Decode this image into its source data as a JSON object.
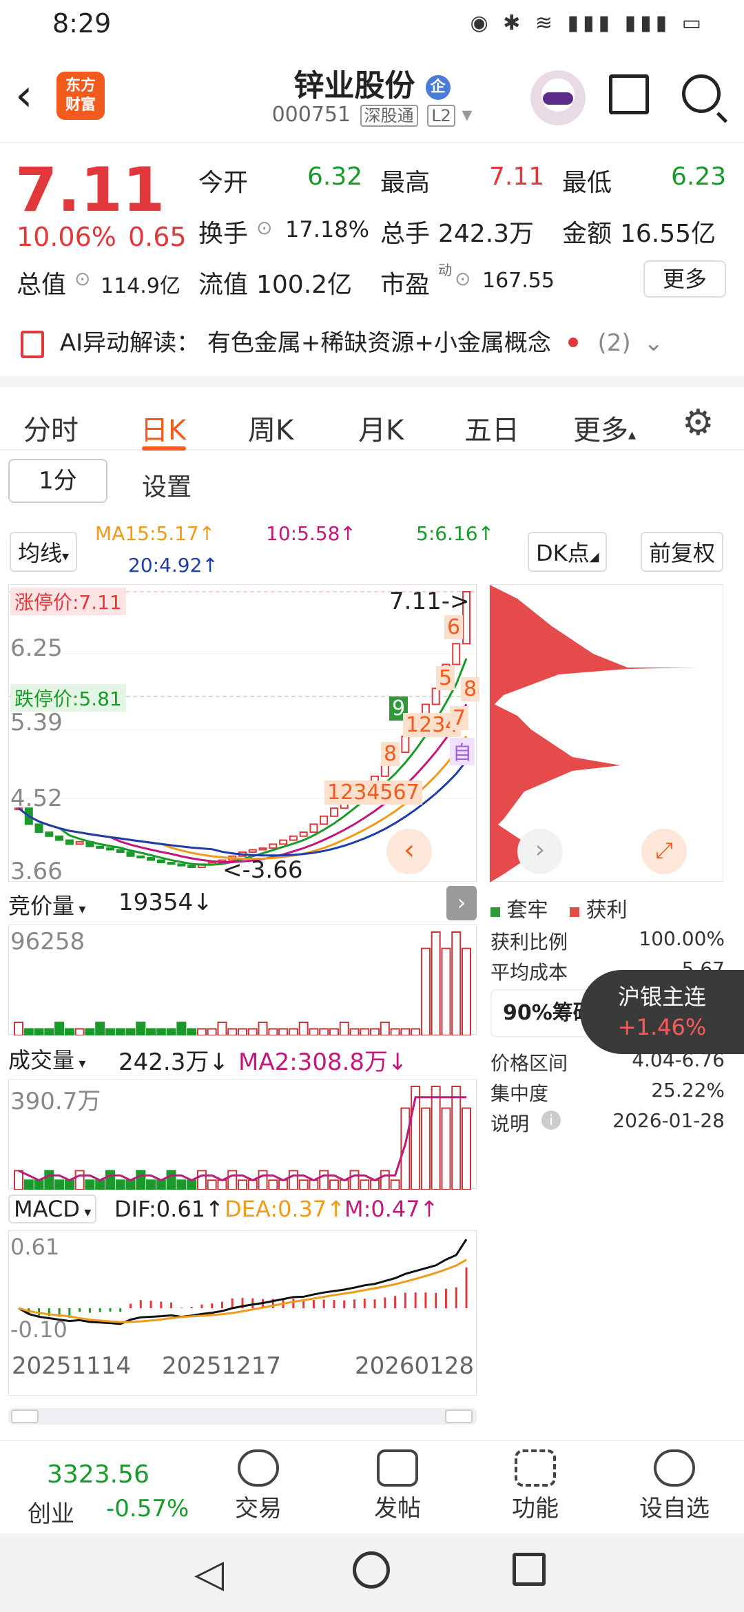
{
  "status": {
    "time": "8:29"
  },
  "header": {
    "logo_line1": "东方",
    "logo_line2": "财富",
    "name": "锌业股份",
    "name_badge": "企",
    "code": "000751",
    "tag1": "深股通",
    "tag2": "L2"
  },
  "quote": {
    "price": "7.11",
    "pct": "10.06%",
    "change": "0.65",
    "open_label": "今开",
    "open": "6.32",
    "high_label": "最高",
    "high": "7.11",
    "low_label": "最低",
    "low": "6.23",
    "turnover_label": "换手",
    "turnover": "17.18%",
    "volume_label": "总手",
    "volume": "242.3万",
    "amount_label": "金额",
    "amount": "16.55亿",
    "mktcap_label": "总值",
    "mktcap": "114.9亿",
    "float_label": "流值",
    "float": "100.2亿",
    "pe_label": "市盈",
    "pe_sup": "动",
    "pe": "167.55",
    "more": "更多"
  },
  "ai": {
    "prefix": "AI异动解读：",
    "text": "有色金属+稀缺资源+小金属概念",
    "count": "(2)"
  },
  "tabs": [
    "分时",
    "日K",
    "周K",
    "月K",
    "五日",
    "更多"
  ],
  "period": {
    "selected": "1分",
    "settings": "设置"
  },
  "ma": {
    "dropdown": "均线",
    "ma15": "MA15:5.17↑",
    "ma10": "10:5.58↑",
    "ma5": "5:6.16↑",
    "ma20": "20:4.92↑",
    "dk": "DK点",
    "adjust": "前复权"
  },
  "kline": {
    "limit_up": "涨停价:7.11",
    "limit_down": "跌停价:5.81",
    "y_labels": [
      "6.25",
      "5.39",
      "4.52",
      "3.66"
    ],
    "last_marker": "7.11->",
    "low_marker": "<-3.66",
    "count_labels": [
      "1",
      "2",
      "3",
      "4",
      "5",
      "6",
      "7",
      "8",
      "9",
      "1",
      "2",
      "3",
      "4",
      "5",
      "6",
      "7",
      "8",
      "自"
    ]
  },
  "auction": {
    "dropdown": "竞价量",
    "value": "19354↓",
    "y_label": "96258"
  },
  "volume": {
    "dropdown": "成交量",
    "value": "242.3万↓",
    "ma2": "MA2:308.8万↓",
    "y_label": "390.7万"
  },
  "macd": {
    "dropdown": "MACD",
    "dif": "DIF:0.61↑",
    "dea": "DEA:0.37↑",
    "m": "M:0.47↑",
    "y_top": "0.61",
    "y_bottom": "-0.10"
  },
  "x_dates": [
    "20251114",
    "20251217",
    "20260128"
  ],
  "chip": {
    "legend_trap": "套牢",
    "legend_profit": "获利",
    "rows": [
      {
        "label": "获利比例",
        "value": "100.00%"
      },
      {
        "label": "平均成本",
        "value": "5.67"
      },
      {
        "label": "价格区间",
        "value": "4.04-6.76"
      },
      {
        "label": "集中度",
        "value": "25.22%"
      },
      {
        "label": "说明",
        "value": "2026-01-28"
      }
    ],
    "chip_label": "90%筹码"
  },
  "toast": {
    "title": "沪银主连",
    "value": "+1.46%"
  },
  "bottom": {
    "index_value": "3323.56",
    "index_name": "创业",
    "index_pct": "-0.57%",
    "items": [
      "交易",
      "发帖",
      "功能",
      "设自选"
    ]
  },
  "chart_data": {
    "type": "candlestick",
    "note_ranges": {
      "price_ylim": [
        3.66,
        7.11
      ]
    },
    "x_labels": [
      "20251114",
      "20251217",
      "20260128"
    ],
    "closes": [
      4.4,
      4.2,
      4.1,
      4.05,
      4.0,
      3.95,
      3.98,
      3.92,
      3.9,
      3.88,
      3.85,
      3.8,
      3.78,
      3.75,
      3.72,
      3.7,
      3.68,
      3.66,
      3.7,
      3.72,
      3.75,
      3.8,
      3.85,
      3.88,
      3.9,
      3.95,
      4.0,
      4.05,
      4.1,
      4.2,
      4.3,
      4.4,
      4.5,
      4.6,
      4.7,
      4.8,
      4.95,
      5.1,
      5.3,
      5.5,
      5.7,
      5.9,
      6.2,
      6.46,
      7.11
    ],
    "volume_ylim": [
      0,
      390.7
    ]
  }
}
